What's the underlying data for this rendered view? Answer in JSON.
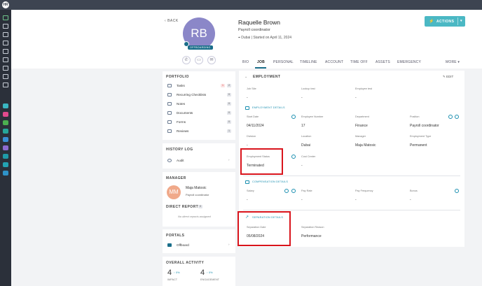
{
  "topbar": {
    "logo": "HR"
  },
  "rail_icons": [
    "leaf-icon",
    "id-card-icon",
    "list-icon",
    "people-icon",
    "folder-icon",
    "clipboard-icon",
    "calendar-icon",
    "document-icon",
    "gear-icon",
    "teal-icon",
    "pink-icon",
    "green-icon",
    "teal-icon-2",
    "blue-icon",
    "purple-icon",
    "teal-icon-3",
    "teal-icon-4",
    "grid-icon"
  ],
  "header": {
    "back_label": "BACK",
    "initials": "RB",
    "status_badge": "OFFBOARDING",
    "name": "Raquelle Brown",
    "title": "Payroll coordinator",
    "location": "Dubai | Started on April 11, 2024",
    "actions_label": "ACTIONS",
    "tabs": [
      "BIO",
      "JOB",
      "PERSONAL",
      "TIMELINE",
      "ACCOUNT",
      "TIME OFF",
      "ASSETS",
      "EMERGENCY",
      "MORE"
    ]
  },
  "portfolio": {
    "title": "PORTFOLIO",
    "items": [
      {
        "label": "Tasks",
        "count": "2",
        "extra": "1",
        "icon": "checklist-icon"
      },
      {
        "label": "Recurring Checklists",
        "count": "0",
        "icon": "repeat-icon"
      },
      {
        "label": "Notes",
        "count": "0",
        "icon": "note-icon"
      },
      {
        "label": "Documents",
        "count": "0",
        "icon": "document-icon"
      },
      {
        "label": "Forms",
        "count": "0",
        "icon": "form-icon"
      },
      {
        "label": "Reviews",
        "count": "1",
        "icon": "review-icon"
      }
    ]
  },
  "history": {
    "title": "HISTORY LOG",
    "item": "Audit"
  },
  "manager": {
    "title": "MANAGER",
    "initials": "MM",
    "name": "Maja Matosic",
    "role": "Payroll coordinator",
    "direct_title": "DIRECT REPORTS",
    "direct_count": "0",
    "direct_empty": "No direct reports assigned"
  },
  "portals": {
    "title": "PORTALS",
    "item": "Offboard"
  },
  "activity": {
    "title": "OVERALL ACTIVITY",
    "impact_value": "4",
    "impact_trend": "0%",
    "impact_label": "IMPACT",
    "engagement_value": "4",
    "engagement_trend": "0%",
    "engagement_label": "ENGAGEMENT"
  },
  "employment": {
    "title": "EMPLOYMENT",
    "edit_label": "EDIT",
    "top_fields": [
      {
        "label": "Job Site",
        "value": "-"
      },
      {
        "label": "Lookup test",
        "value": "-"
      },
      {
        "label": "Employee test",
        "value": "-"
      }
    ],
    "details_title": "EMPLOYMENT DETAILS",
    "fields_row1": [
      {
        "label": "Start Date",
        "value": "04/11/2024"
      },
      {
        "label": "Employee Number",
        "value": "17"
      },
      {
        "label": "Department",
        "value": "Finance"
      },
      {
        "label": "Position",
        "value": "Payroll coordinator"
      }
    ],
    "fields_row2": [
      {
        "label": "Division",
        "value": "-"
      },
      {
        "label": "Location",
        "value": "Dubai"
      },
      {
        "label": "Manager",
        "value": "Maja Matosic"
      },
      {
        "label": "Employment Type",
        "value": "Permanent"
      }
    ],
    "fields_row3": [
      {
        "label": "Employment Status",
        "value": "Terminated"
      },
      {
        "label": "Cost Center",
        "value": "-"
      }
    ],
    "comp_title": "COMPENSATION DETAILS",
    "comp_fields": [
      {
        "label": "Salary",
        "value": "-"
      },
      {
        "label": "Pay Rate",
        "value": "-"
      },
      {
        "label": "Pay Frequency",
        "value": "-"
      },
      {
        "label": "Bonus",
        "value": "-"
      }
    ],
    "sep_title": "SEPARATION DETAILS",
    "sep_fields": [
      {
        "label": "Separation Date",
        "value": "05/08/2024"
      },
      {
        "label": "Separation Reason",
        "value": "Performance"
      }
    ]
  }
}
